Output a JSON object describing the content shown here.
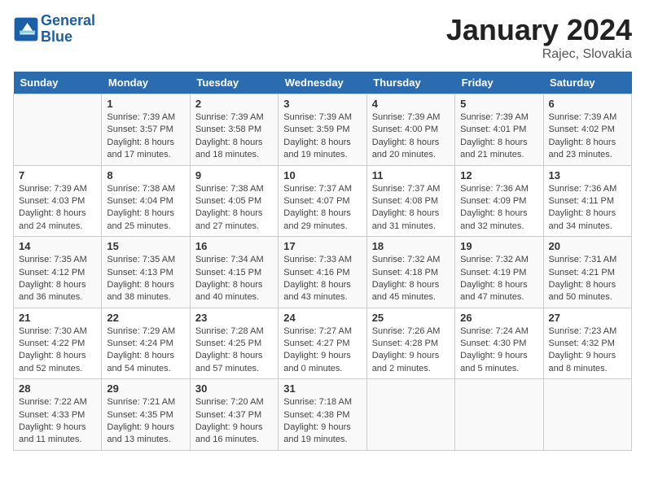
{
  "header": {
    "logo_line1": "General",
    "logo_line2": "Blue",
    "month": "January 2024",
    "location": "Rajec, Slovakia"
  },
  "weekdays": [
    "Sunday",
    "Monday",
    "Tuesday",
    "Wednesday",
    "Thursday",
    "Friday",
    "Saturday"
  ],
  "weeks": [
    [
      {
        "num": "",
        "info": ""
      },
      {
        "num": "1",
        "info": "Sunrise: 7:39 AM\nSunset: 3:57 PM\nDaylight: 8 hours\nand 17 minutes."
      },
      {
        "num": "2",
        "info": "Sunrise: 7:39 AM\nSunset: 3:58 PM\nDaylight: 8 hours\nand 18 minutes."
      },
      {
        "num": "3",
        "info": "Sunrise: 7:39 AM\nSunset: 3:59 PM\nDaylight: 8 hours\nand 19 minutes."
      },
      {
        "num": "4",
        "info": "Sunrise: 7:39 AM\nSunset: 4:00 PM\nDaylight: 8 hours\nand 20 minutes."
      },
      {
        "num": "5",
        "info": "Sunrise: 7:39 AM\nSunset: 4:01 PM\nDaylight: 8 hours\nand 21 minutes."
      },
      {
        "num": "6",
        "info": "Sunrise: 7:39 AM\nSunset: 4:02 PM\nDaylight: 8 hours\nand 23 minutes."
      }
    ],
    [
      {
        "num": "7",
        "info": "Sunrise: 7:39 AM\nSunset: 4:03 PM\nDaylight: 8 hours\nand 24 minutes."
      },
      {
        "num": "8",
        "info": "Sunrise: 7:38 AM\nSunset: 4:04 PM\nDaylight: 8 hours\nand 25 minutes."
      },
      {
        "num": "9",
        "info": "Sunrise: 7:38 AM\nSunset: 4:05 PM\nDaylight: 8 hours\nand 27 minutes."
      },
      {
        "num": "10",
        "info": "Sunrise: 7:37 AM\nSunset: 4:07 PM\nDaylight: 8 hours\nand 29 minutes."
      },
      {
        "num": "11",
        "info": "Sunrise: 7:37 AM\nSunset: 4:08 PM\nDaylight: 8 hours\nand 31 minutes."
      },
      {
        "num": "12",
        "info": "Sunrise: 7:36 AM\nSunset: 4:09 PM\nDaylight: 8 hours\nand 32 minutes."
      },
      {
        "num": "13",
        "info": "Sunrise: 7:36 AM\nSunset: 4:11 PM\nDaylight: 8 hours\nand 34 minutes."
      }
    ],
    [
      {
        "num": "14",
        "info": "Sunrise: 7:35 AM\nSunset: 4:12 PM\nDaylight: 8 hours\nand 36 minutes."
      },
      {
        "num": "15",
        "info": "Sunrise: 7:35 AM\nSunset: 4:13 PM\nDaylight: 8 hours\nand 38 minutes."
      },
      {
        "num": "16",
        "info": "Sunrise: 7:34 AM\nSunset: 4:15 PM\nDaylight: 8 hours\nand 40 minutes."
      },
      {
        "num": "17",
        "info": "Sunrise: 7:33 AM\nSunset: 4:16 PM\nDaylight: 8 hours\nand 43 minutes."
      },
      {
        "num": "18",
        "info": "Sunrise: 7:32 AM\nSunset: 4:18 PM\nDaylight: 8 hours\nand 45 minutes."
      },
      {
        "num": "19",
        "info": "Sunrise: 7:32 AM\nSunset: 4:19 PM\nDaylight: 8 hours\nand 47 minutes."
      },
      {
        "num": "20",
        "info": "Sunrise: 7:31 AM\nSunset: 4:21 PM\nDaylight: 8 hours\nand 50 minutes."
      }
    ],
    [
      {
        "num": "21",
        "info": "Sunrise: 7:30 AM\nSunset: 4:22 PM\nDaylight: 8 hours\nand 52 minutes."
      },
      {
        "num": "22",
        "info": "Sunrise: 7:29 AM\nSunset: 4:24 PM\nDaylight: 8 hours\nand 54 minutes."
      },
      {
        "num": "23",
        "info": "Sunrise: 7:28 AM\nSunset: 4:25 PM\nDaylight: 8 hours\nand 57 minutes."
      },
      {
        "num": "24",
        "info": "Sunrise: 7:27 AM\nSunset: 4:27 PM\nDaylight: 9 hours\nand 0 minutes."
      },
      {
        "num": "25",
        "info": "Sunrise: 7:26 AM\nSunset: 4:28 PM\nDaylight: 9 hours\nand 2 minutes."
      },
      {
        "num": "26",
        "info": "Sunrise: 7:24 AM\nSunset: 4:30 PM\nDaylight: 9 hours\nand 5 minutes."
      },
      {
        "num": "27",
        "info": "Sunrise: 7:23 AM\nSunset: 4:32 PM\nDaylight: 9 hours\nand 8 minutes."
      }
    ],
    [
      {
        "num": "28",
        "info": "Sunrise: 7:22 AM\nSunset: 4:33 PM\nDaylight: 9 hours\nand 11 minutes."
      },
      {
        "num": "29",
        "info": "Sunrise: 7:21 AM\nSunset: 4:35 PM\nDaylight: 9 hours\nand 13 minutes."
      },
      {
        "num": "30",
        "info": "Sunrise: 7:20 AM\nSunset: 4:37 PM\nDaylight: 9 hours\nand 16 minutes."
      },
      {
        "num": "31",
        "info": "Sunrise: 7:18 AM\nSunset: 4:38 PM\nDaylight: 9 hours\nand 19 minutes."
      },
      {
        "num": "",
        "info": ""
      },
      {
        "num": "",
        "info": ""
      },
      {
        "num": "",
        "info": ""
      }
    ]
  ]
}
